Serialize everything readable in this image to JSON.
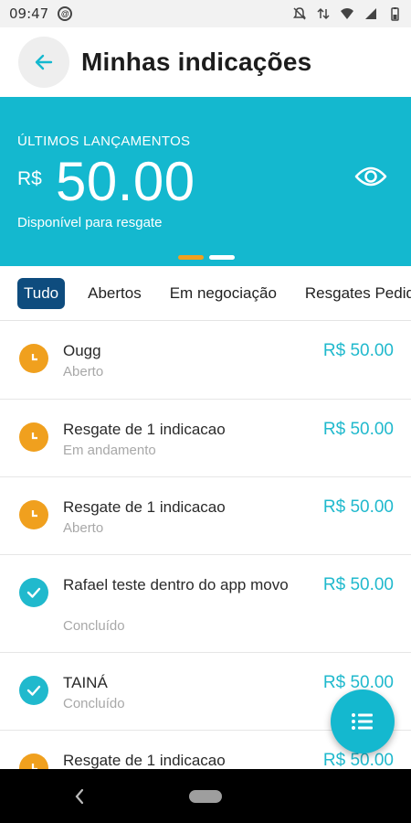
{
  "status_bar": {
    "time": "09:47",
    "icons": [
      "notification-at-icon",
      "mute-icon",
      "data-arrows-icon",
      "wifi-icon",
      "signal-icon",
      "battery-icon"
    ]
  },
  "header": {
    "title": "Minhas indicações",
    "back_icon": "arrow-left-icon"
  },
  "banner": {
    "caption": "ÚLTIMOS LANÇAMENTOS",
    "currency": "R$",
    "amount": "50.00",
    "subtitle": "Disponível para resgate",
    "eye_icon": "eye-icon",
    "pager": {
      "count": 2,
      "active": 0
    }
  },
  "tabs": [
    {
      "label": "Tudo",
      "active": true
    },
    {
      "label": "Abertos",
      "active": false
    },
    {
      "label": "Em negociação",
      "active": false
    },
    {
      "label": "Resgates Pedidos",
      "active": false
    }
  ],
  "items": [
    {
      "name": "Ougg",
      "status": "Aberto",
      "value": "R$ 50.00",
      "icon": "clock-icon"
    },
    {
      "name": "Resgate de 1 indicacao",
      "status": "Em andamento",
      "value": "R$ 50.00",
      "icon": "clock-icon"
    },
    {
      "name": "Resgate de 1 indicacao",
      "status": "Aberto",
      "value": "R$ 50.00",
      "icon": "clock-icon"
    },
    {
      "name": "Rafael teste dentro do app movo",
      "status": "Concluído",
      "value": "R$ 50.00",
      "icon": "check-icon"
    },
    {
      "name": "TAINÁ",
      "status": "Concluído",
      "value": "R$ 50.00",
      "icon": "check-icon"
    },
    {
      "name": "Resgate de 1 indicacao",
      "status": "",
      "value": "R$ 50.00",
      "icon": "clock-icon"
    }
  ],
  "fab": {
    "icon": "list-icon"
  },
  "colors": {
    "accent": "#14b8cf",
    "tab_active": "#0e4c7e",
    "pending": "#f0a01e",
    "done": "#20b9cd",
    "pager_active": "#f0a01e",
    "pager_inactive": "#ffffff"
  }
}
